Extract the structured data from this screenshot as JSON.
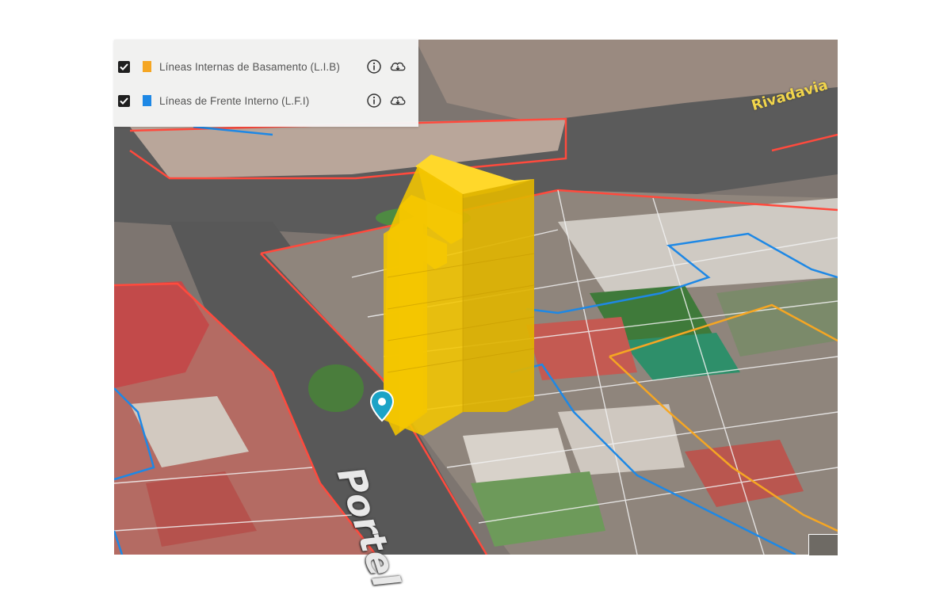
{
  "legend": {
    "layers": [
      {
        "label": "Líneas Internas de Basamento (L.I.B)",
        "color": "#f5a623",
        "checked": true,
        "info_icon": "info-circle-icon",
        "download_icon": "cloud-download-icon"
      },
      {
        "label": "Líneas de Frente Interno (L.F.I)",
        "color": "#1e88e5",
        "checked": true,
        "info_icon": "info-circle-icon",
        "download_icon": "cloud-download-icon"
      }
    ]
  },
  "map": {
    "street_labels": {
      "portela": "Portel",
      "rivadavia": "Rivadavia"
    },
    "colors": {
      "parcel_line": "#ff4a3d",
      "lib_line": "#f5a623",
      "lfi_line": "#1e88e5",
      "building": "#f2c200",
      "marker": "#1ba3c6"
    },
    "marker_icon": "map-pin-icon",
    "basemap_toggle_icon": "basemap-thumbnail-icon"
  }
}
